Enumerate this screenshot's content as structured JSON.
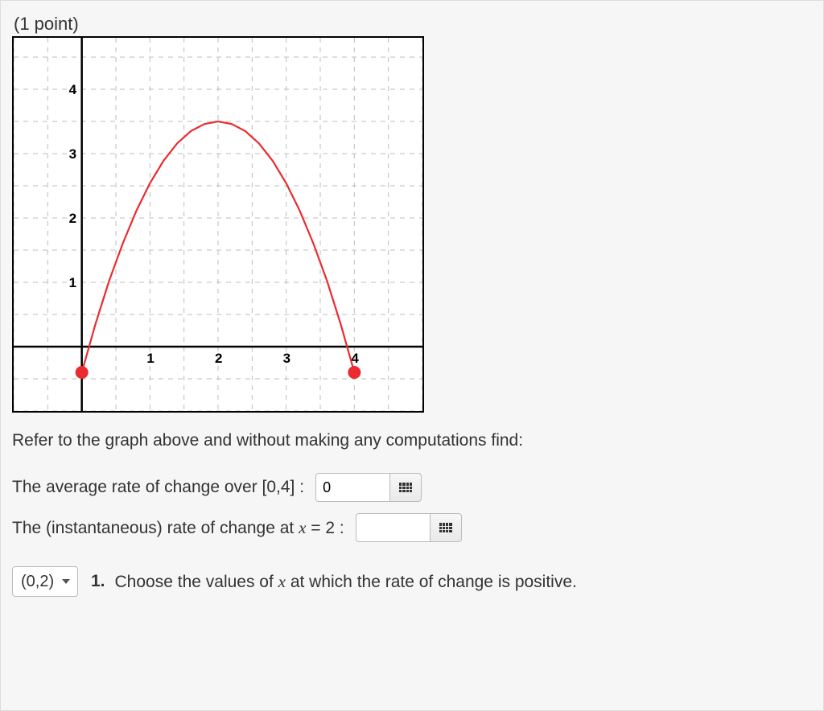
{
  "points_label": "(1 point)",
  "prompt_text": "Refer to the graph above and without making any computations find:",
  "row1": {
    "label_pre": "The average rate of change over [0,4] :",
    "input_value": "0"
  },
  "row2": {
    "label_pre": "The (instantaneous) rate of change at ",
    "math_var": "x",
    "eq_text": " = 2 :",
    "input_value": ""
  },
  "row3": {
    "dropdown_selected": "(0,2)",
    "dropdown_options": [
      "(0,2)"
    ],
    "number": "1.",
    "question_pre": " Choose the values of ",
    "math_var": "x",
    "question_post": " at which the rate of change is positive."
  },
  "chart_data": {
    "type": "line",
    "title": "",
    "xlabel": "",
    "ylabel": "",
    "xlim": [
      -1,
      5
    ],
    "ylim": [
      -1,
      4.8
    ],
    "x_ticks": [
      1,
      2,
      3,
      4
    ],
    "y_ticks": [
      1,
      2,
      3,
      4
    ],
    "series": [
      {
        "name": "curve",
        "type": "parabola",
        "color": "#eb2b2f",
        "x": [
          0.0,
          0.2,
          0.4,
          0.6,
          0.8,
          1.0,
          1.2,
          1.4,
          1.6,
          1.8,
          2.0,
          2.2,
          2.4,
          2.6,
          2.8,
          3.0,
          3.2,
          3.4,
          3.6,
          3.8,
          4.0
        ],
        "y": [
          -0.4,
          0.35,
          1.02,
          1.6,
          2.11,
          2.54,
          2.89,
          3.16,
          3.35,
          3.46,
          3.5,
          3.46,
          3.35,
          3.16,
          2.89,
          2.54,
          2.11,
          1.6,
          1.02,
          0.35,
          -0.4
        ],
        "endpoint_markers": [
          {
            "x": 0.0,
            "y": -0.4,
            "filled": true
          },
          {
            "x": 4.0,
            "y": -0.4,
            "filled": true
          }
        ]
      }
    ],
    "grid": {
      "major": 1,
      "minor": 0.5
    }
  }
}
